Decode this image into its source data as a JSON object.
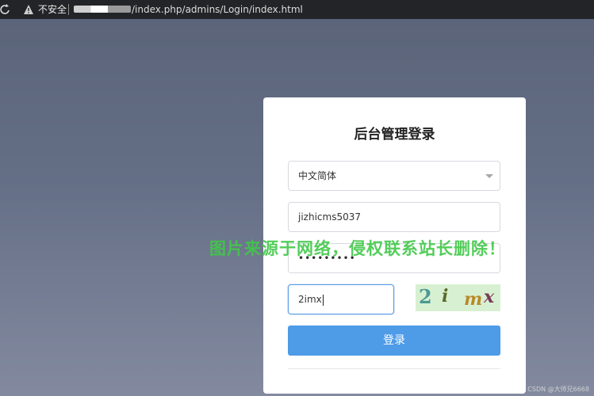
{
  "browser": {
    "security_label": "不安全",
    "url_path": "/index.php/admins/Login/index.html"
  },
  "login": {
    "title": "后台管理登录",
    "language_selected": "中文简体",
    "username_value": "jizhicms5037",
    "password_mask": "•••••••••",
    "captcha_input_value": "2imx",
    "captcha_chars": [
      "2",
      "i",
      "m",
      "x"
    ],
    "submit_label": "登录"
  },
  "overlay": {
    "watermark_text": "图片来源于网络，侵权联系站长删除！",
    "credit_text": "CSDN @大师兄6668"
  },
  "colors": {
    "primary": "#4e9be8",
    "background": "#646e85",
    "watermark": "#40c848"
  }
}
